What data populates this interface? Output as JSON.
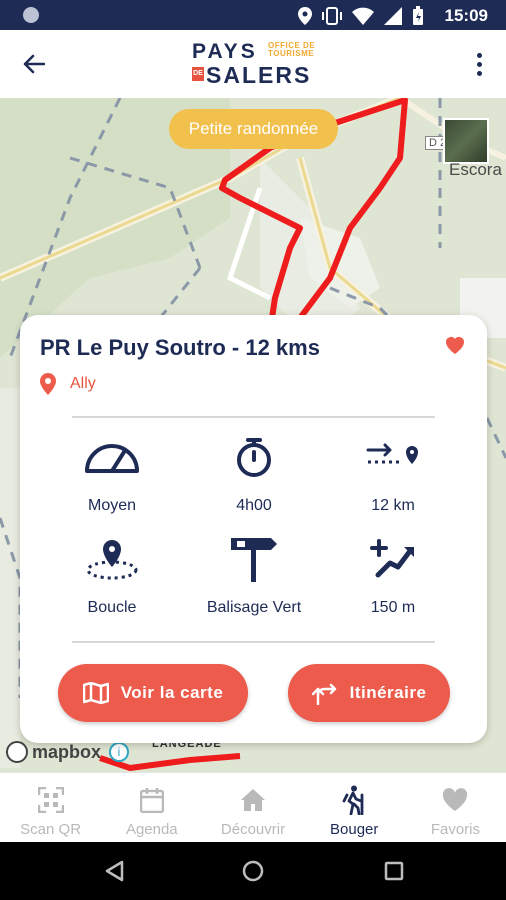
{
  "status_bar": {
    "time": "15:09"
  },
  "header": {
    "logo_line1": "PAYS",
    "logo_line2": "SALERS",
    "logo_small_de": "DE",
    "logo_office": "OFFICE DE\nTOURISME"
  },
  "map": {
    "category_pill": "Petite randonnée",
    "road_label": "D 2",
    "place_label": "Escora",
    "village_label": "LANGEADE",
    "attribution": "mapbox"
  },
  "card": {
    "title": "PR Le Puy Soutro - 12 kms",
    "location": "Ally",
    "features": [
      {
        "icon": "difficulty-gauge-icon",
        "label": "Moyen"
      },
      {
        "icon": "stopwatch-icon",
        "label": "4h00"
      },
      {
        "icon": "distance-route-icon",
        "label": "12 km"
      },
      {
        "icon": "loop-pin-icon",
        "label": "Boucle"
      },
      {
        "icon": "signpost-icon",
        "label": "Balisage Vert"
      },
      {
        "icon": "elevation-gain-icon",
        "label": "150 m"
      }
    ],
    "btn_map": "Voir la carte",
    "btn_route": "Itinéraire"
  },
  "nav": {
    "items": [
      {
        "label": "Scan QR",
        "icon": "qr-code-icon",
        "active": false
      },
      {
        "label": "Agenda",
        "icon": "calendar-icon",
        "active": false
      },
      {
        "label": "Découvrir",
        "icon": "home-icon",
        "active": false
      },
      {
        "label": "Bouger",
        "icon": "hiker-icon",
        "active": true
      },
      {
        "label": "Favoris",
        "icon": "heart-icon",
        "active": false
      }
    ]
  },
  "colors": {
    "brand_navy": "#1d2b55",
    "accent_red": "#ec5b4c",
    "pill_yellow": "#f2c04c",
    "trail_red": "#ee1c1c"
  }
}
